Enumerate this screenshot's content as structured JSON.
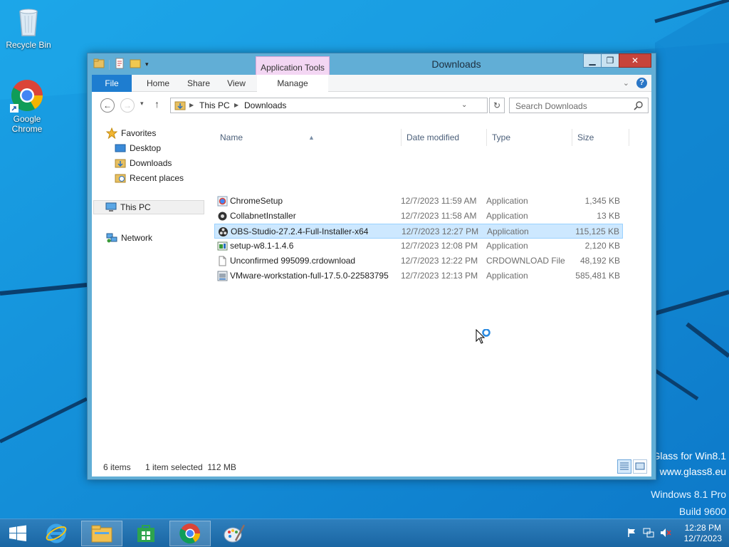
{
  "desktop": {
    "icons": [
      {
        "label": "Recycle Bin"
      },
      {
        "label": "Google Chrome"
      }
    ],
    "watermark": {
      "line1": "Glass for Win8.1",
      "line2": "www.glass8.eu",
      "os": "Windows 8.1 Pro",
      "build": "Build 9600"
    }
  },
  "window": {
    "title": "Downloads",
    "context_tab": "Application Tools",
    "ribbon_tabs": [
      "File",
      "Home",
      "Share",
      "View",
      "Manage"
    ],
    "address": {
      "crumbs": [
        "This PC",
        "Downloads"
      ]
    },
    "search_placeholder": "Search Downloads",
    "nav_pane": {
      "favorites": "Favorites",
      "favorite_items": [
        "Desktop",
        "Downloads",
        "Recent places"
      ],
      "this_pc": "This PC",
      "network": "Network"
    },
    "columns": [
      "Name",
      "Date modified",
      "Type",
      "Size"
    ],
    "files": [
      {
        "name": "ChromeSetup",
        "date": "12/7/2023 11:59 AM",
        "type": "Application",
        "size": "1,345 KB",
        "icon": "chrome-setup-icon"
      },
      {
        "name": "CollabnetInstaller",
        "date": "12/7/2023 11:58 AM",
        "type": "Application",
        "size": "13 KB",
        "icon": "installer-icon"
      },
      {
        "name": "OBS-Studio-27.2.4-Full-Installer-x64",
        "date": "12/7/2023 12:27 PM",
        "type": "Application",
        "size": "115,125 KB",
        "icon": "obs-icon",
        "selected": true
      },
      {
        "name": "setup-w8.1-1.4.6",
        "date": "12/7/2023 12:08 PM",
        "type": "Application",
        "size": "2,120 KB",
        "icon": "setup-icon"
      },
      {
        "name": "Unconfirmed 995099.crdownload",
        "date": "12/7/2023 12:22 PM",
        "type": "CRDOWNLOAD File",
        "size": "48,192 KB",
        "icon": "file-icon"
      },
      {
        "name": "VMware-workstation-full-17.5.0-22583795",
        "date": "12/7/2023 12:13 PM",
        "type": "Application",
        "size": "585,481 KB",
        "icon": "vmware-icon"
      }
    ],
    "status": {
      "items": "6 items",
      "selection": "1 item selected  112 MB"
    }
  },
  "taskbar": {
    "apps": [
      "start-icon",
      "internet-explorer-icon",
      "file-explorer-icon",
      "store-icon",
      "chrome-icon",
      "paint-icon"
    ],
    "clock": {
      "time": "12:28 PM",
      "date": "12/7/2023"
    }
  },
  "colors": {
    "accent": "#1e7dd0",
    "selection": "#cde8ff",
    "context_tab": "#f3d6f3",
    "taskbar": "#1a66a3"
  }
}
